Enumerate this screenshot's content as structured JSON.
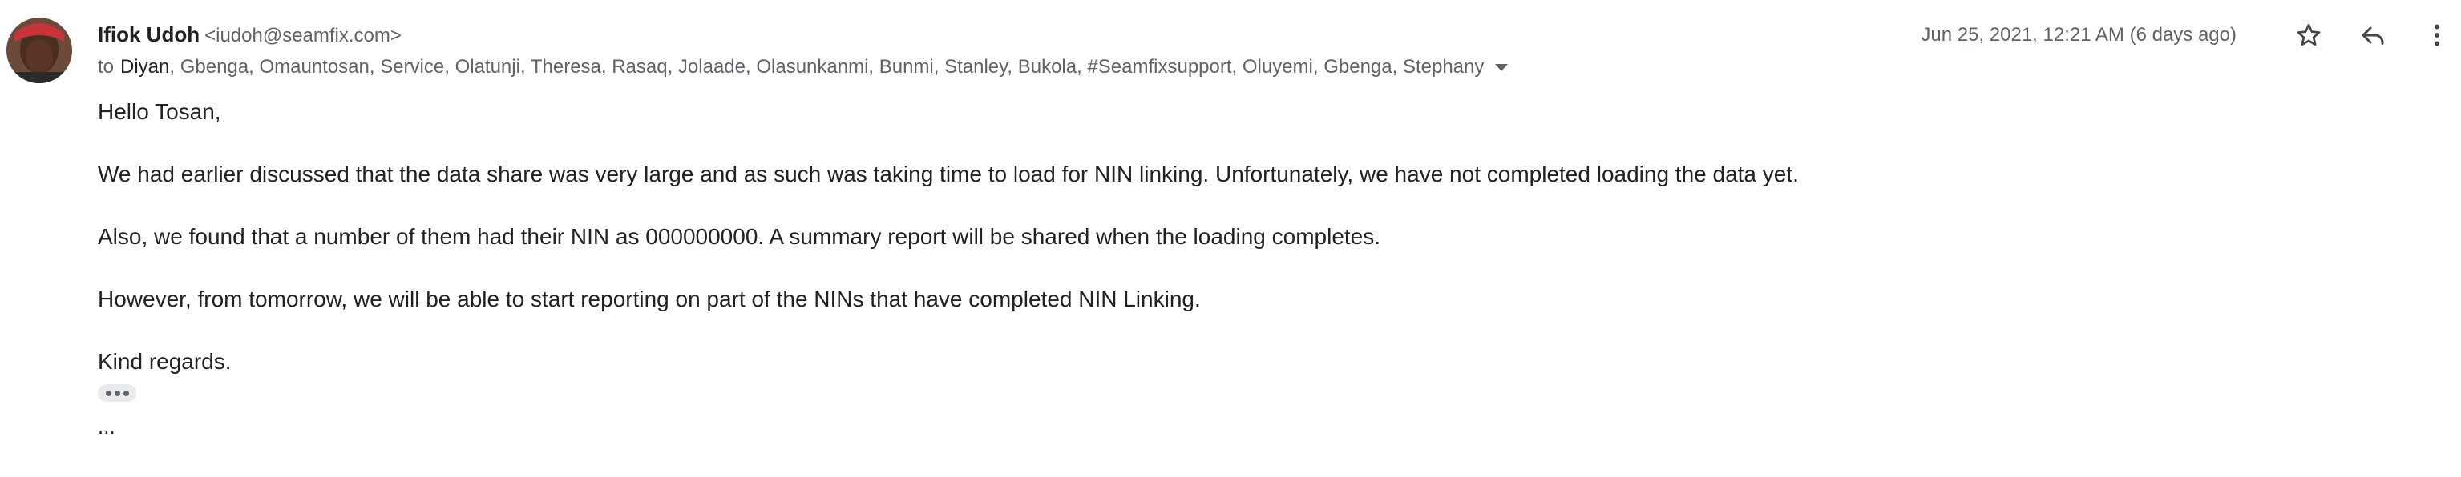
{
  "header": {
    "sender_name": "Ifiok Udoh",
    "sender_email": "<iudoh@seamfix.com>",
    "timestamp": "Jun 25, 2021, 12:21 AM (6 days ago)",
    "to_label": "to",
    "first_recipient": "Diyan",
    "other_recipients": ", Gbenga, Omauntosan, Service, Olatunji, Theresa, Rasaq, Jolaade, Olasunkanmi, Bunmi, Stanley, Bukola, #Seamfixsupport, Oluyemi, Gbenga, Stephany"
  },
  "actions": {
    "star": "star-icon",
    "reply": "reply-icon",
    "more": "more-vert-icon",
    "recipients_dropdown": "arrow-drop-down-icon"
  },
  "body": {
    "greeting": "Hello Tosan,",
    "paragraph1": "We had earlier discussed that the data share was very large and as such was taking time to load for NIN linking. Unfortunately, we have not completed loading the data yet.",
    "paragraph2": "Also, we found that a number of them had their NIN as 000000000. A summary report will be shared when the loading completes.",
    "paragraph3": "However, from tomorrow, we will be able to start reporting on part of the NINs that have completed NIN Linking.",
    "closing": "Kind regards.",
    "trailing": "..."
  },
  "colors": {
    "primary_text": "#202124",
    "secondary_text": "#5f6368",
    "body_text": "#222222",
    "chip_bg": "#e8eaed"
  }
}
